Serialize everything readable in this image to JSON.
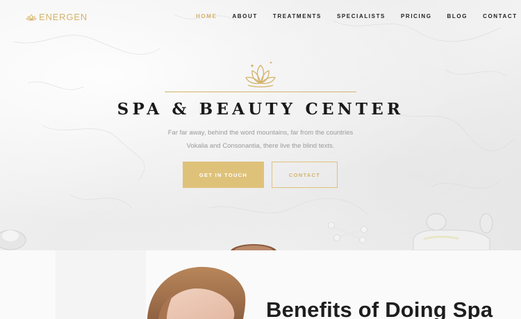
{
  "brand": {
    "name": "ENERGEN",
    "logo_icon": "lotus-icon",
    "accent_color": "#d4b26a"
  },
  "nav": {
    "items": [
      {
        "label": "HOME",
        "active": true
      },
      {
        "label": "ABOUT",
        "active": false
      },
      {
        "label": "TREATMENTS",
        "active": false
      },
      {
        "label": "SPECIALISTS",
        "active": false
      },
      {
        "label": "PRICING",
        "active": false
      },
      {
        "label": "BLOG",
        "active": false
      },
      {
        "label": "CONTACT",
        "active": false
      }
    ]
  },
  "hero": {
    "icon": "lotus-icon",
    "title": "SPA & BEAUTY CENTER",
    "description_line1": "Far far away, behind the word mountains, far from the countries",
    "description_line2": "Vokalia and Consonantia, there live the blind texts.",
    "primary_button": "GET IN TOUCH",
    "secondary_button": "CONTACT"
  },
  "section": {
    "title": "Benefits of Doing Spa"
  }
}
